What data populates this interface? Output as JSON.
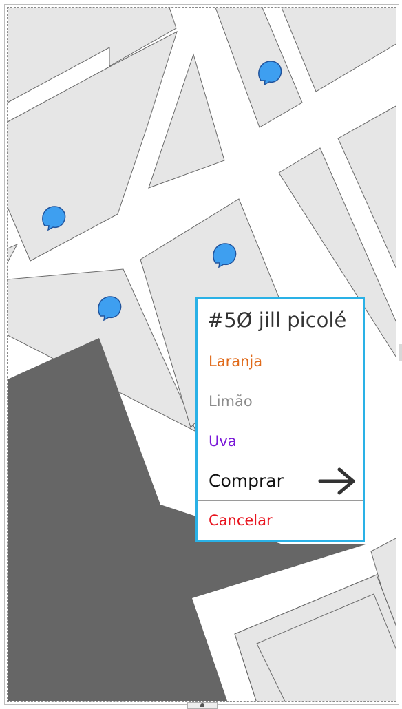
{
  "map": {
    "background": "#ffffff",
    "block_color": "#e6e6e6",
    "dark_area_color": "#666666",
    "pin_color": "#3e9ff0",
    "pins": [
      {
        "name": "map-pin-1"
      },
      {
        "name": "map-pin-2"
      },
      {
        "name": "map-pin-3"
      },
      {
        "name": "map-pin-4"
      }
    ]
  },
  "popup": {
    "border_color": "#2ab1e6",
    "title": "#5Ø jill picolé",
    "options": [
      {
        "label": "Laranja",
        "color": "#e06a1a"
      },
      {
        "label": "Limão",
        "color": "#8c8c8c"
      },
      {
        "label": "Uva",
        "color": "#7a18d8"
      }
    ],
    "buy_label": "Comprar",
    "buy_icon": "arrow-right-icon",
    "cancel_label": "Cancelar",
    "cancel_color": "#e8151f"
  }
}
